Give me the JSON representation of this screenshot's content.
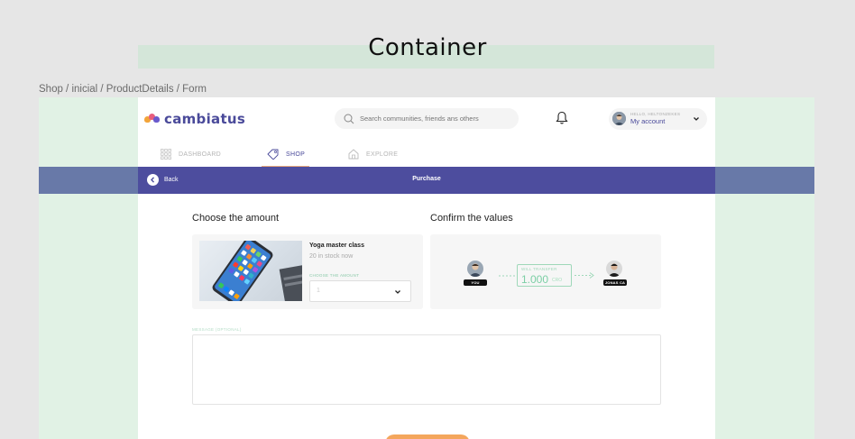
{
  "frame": {
    "title": "Container",
    "breadcrumb": "Shop / inicial / ProductDetails / Form"
  },
  "header": {
    "logo_text": "cambiatus",
    "search_placeholder": "Search communities, friends ans others",
    "account_hello": "HELLO, HELTONZEKES",
    "account_label": "My account"
  },
  "nav": {
    "items": [
      {
        "label": "DASHBOARD",
        "icon": "grid-icon"
      },
      {
        "label": "SHOP",
        "icon": "tag-icon"
      },
      {
        "label": "EXPLORE",
        "icon": "home-icon"
      }
    ],
    "active_index": 1
  },
  "purchase_bar": {
    "back_label": "Back",
    "title": "Purchase"
  },
  "amount_section": {
    "heading": "Choose the amount",
    "product_title": "Yoga master class",
    "stock": "20 in stock now",
    "choose_label": "CHOOSE THE AMOUNT",
    "selected_amount": "1"
  },
  "confirm_section": {
    "heading": "Confirm the values",
    "from_tag": "YOU",
    "to_tag": "JONAS CA",
    "transfer_label": "WILL TRANSFER",
    "transfer_value": "1.000",
    "transfer_unit": "CRO"
  },
  "message": {
    "label": "MESSAGE (OPTIONAL)"
  },
  "colors": {
    "brand_purple": "#4d4d9e",
    "accent_orange": "#f4a65c",
    "accent_green": "#7ccfa5",
    "canvas_green": "#e1f2e5"
  }
}
